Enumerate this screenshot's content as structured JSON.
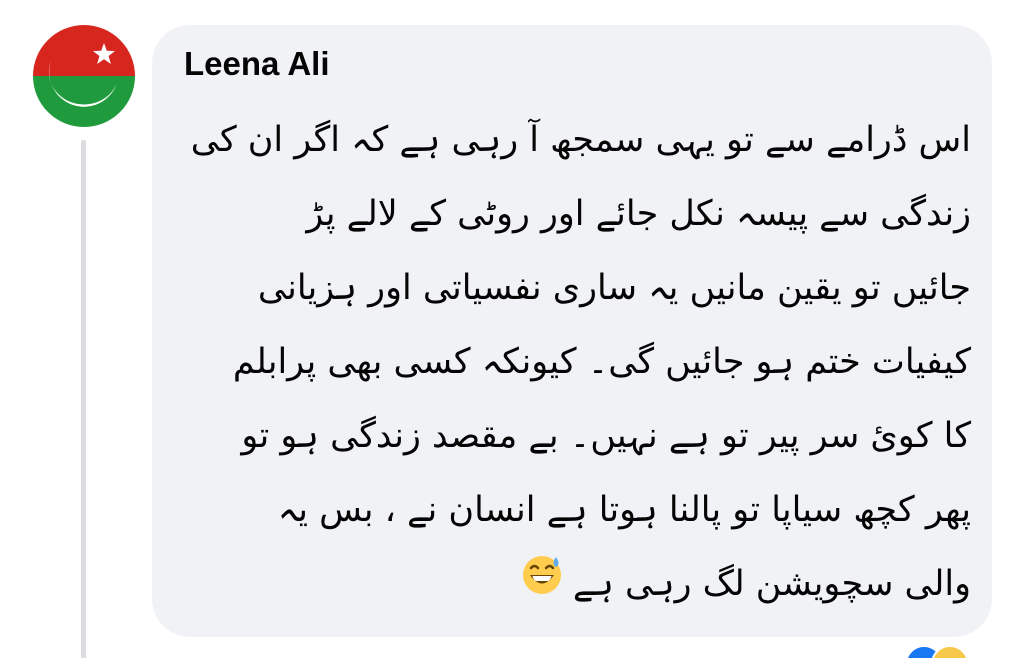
{
  "comment": {
    "author": "Leena Ali",
    "lines": [
      "اس ڈرامے سے تو یہی سمجھ آ رہی ہے کہ اگر ان کی",
      "زندگی سے پیسہ نکل جائے اور روٹی کے لالے پڑ",
      "جائیں تو یقین مانیں یہ ساری نفسیاتی اور ہزیانی",
      "کیفیات ختم ہو جائیں گی۔  کیونکہ کسی بھی پرابلم",
      "کا کوئ سر پیر تو ہے نہیں۔  بے مقصد زندگی ہو تو",
      "پھر کچھ سیاپا تو پالنا ہوتا ہے انسان نے ، بس یہ",
      "والی سچویشن لگ رہی ہے"
    ],
    "emoji": "grinning-face-with-sweat",
    "bubble_color": "#f0f2f5"
  },
  "avatar": {
    "icon": "crescent-star-flag",
    "colors": {
      "top": "#d7261e",
      "bottom": "#1f9a3c",
      "symbol": "#ffffff"
    }
  },
  "reactions": {
    "icons": [
      "like-reaction-icon",
      "haha-reaction-icon"
    ],
    "colors": {
      "like": "#1877f2",
      "haha": "#f7c94b"
    }
  }
}
